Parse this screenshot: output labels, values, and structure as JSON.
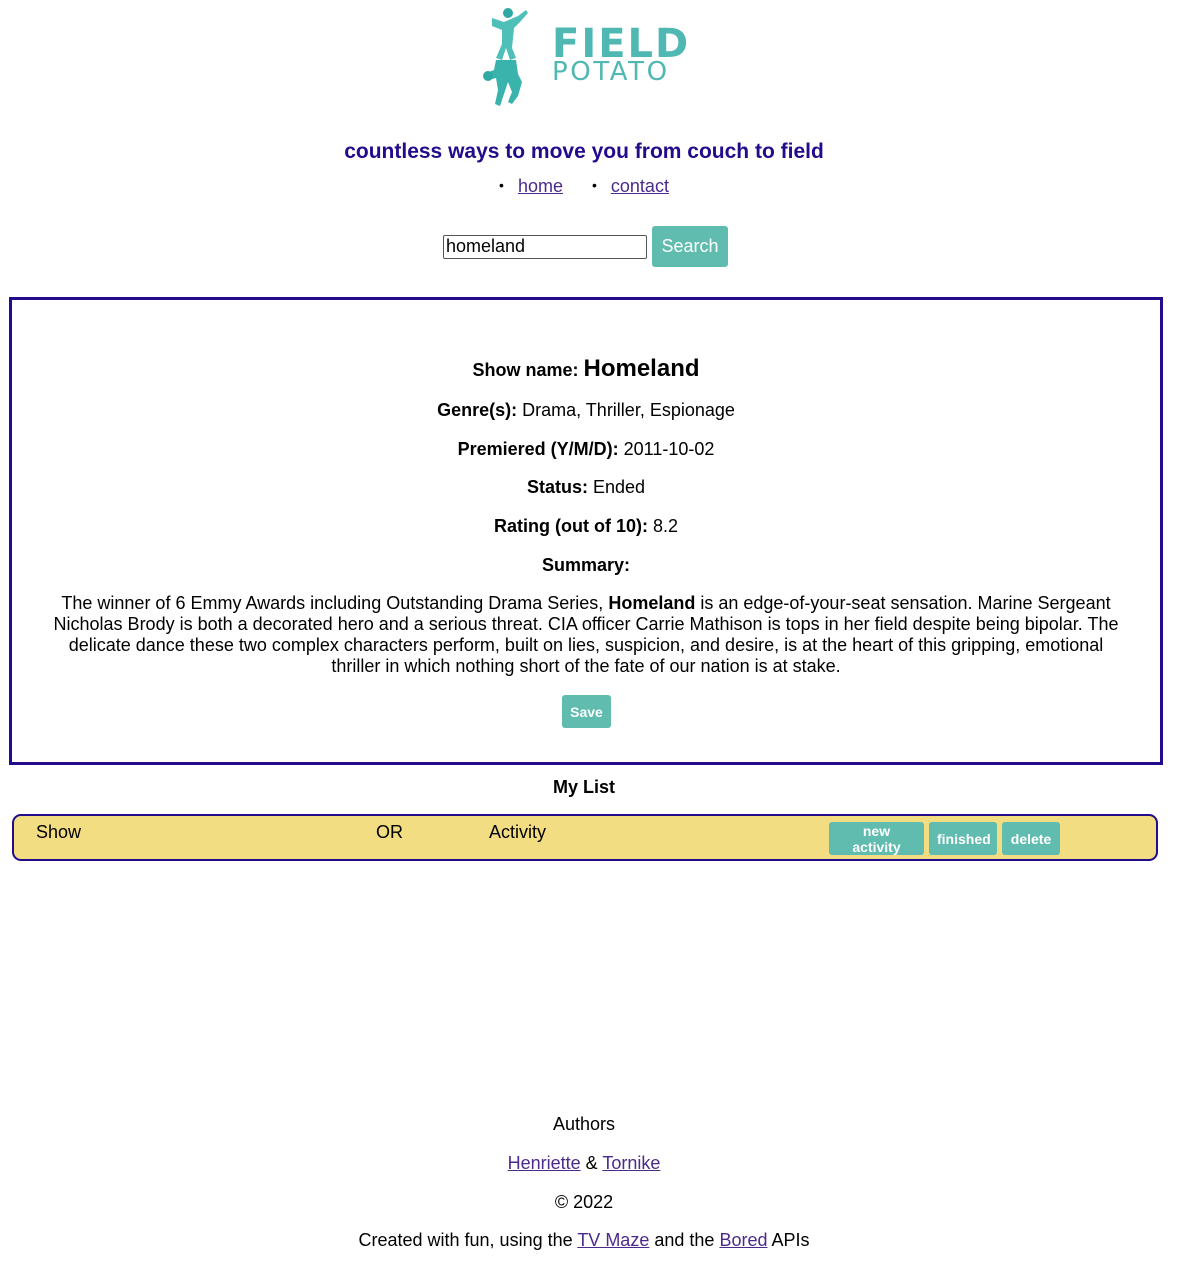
{
  "logo": {
    "line1": "FIELD",
    "line2": "POTATO",
    "icon": "acrobat-figures-icon",
    "color": "#4fb8b3"
  },
  "tagline": "countless ways to move you from couch to field",
  "nav": {
    "items": [
      {
        "label": "home"
      },
      {
        "label": "contact"
      }
    ]
  },
  "search": {
    "value": "homeland",
    "button_label": "Search"
  },
  "show": {
    "name_label": "Show name:",
    "name": "Homeland",
    "genres_label": "Genre(s):",
    "genres": "Drama, Thriller, Espionage",
    "premiered_label": "Premiered (Y/M/D):",
    "premiered": "2011-10-02",
    "status_label": "Status:",
    "status": "Ended",
    "rating_label": "Rating (out of 10):",
    "rating": "8.2",
    "summary_label": "Summary:",
    "summary_before": "The winner of 6 Emmy Awards including Outstanding Drama Series,",
    "summary_bold": "Homeland",
    "summary_after": "is an edge-of-your-seat sensation. Marine Sergeant Nicholas Brody is both a decorated hero and a serious threat. CIA officer Carrie Mathison is tops in her field despite being bipolar. The delicate dance these two complex characters perform, built on lies, suspicion, and desire, is at the heart of this gripping, emotional thriller in which nothing short of the fate of our nation is at stake.",
    "save_label": "Save"
  },
  "my_list": {
    "title": "My List",
    "row": {
      "show": "Show",
      "or": "OR",
      "activity": "Activity",
      "new_activity_label": "new activity",
      "finished_label": "finished",
      "delete_label": "delete"
    }
  },
  "footer": {
    "authors_label": "Authors",
    "author1": "Henriette",
    "author_sep": "&",
    "author2": "Tornike",
    "copyright": "© 2022",
    "credits_before": "Created with fun, using the",
    "api1": "TV Maze",
    "credits_mid": "and the",
    "api2": "Bored",
    "credits_after": "APIs"
  },
  "colors": {
    "accent": "#5fbcae",
    "brand_dark": "#230b8c",
    "list_row": "#f3dd82",
    "link": "#4b2a8c"
  }
}
